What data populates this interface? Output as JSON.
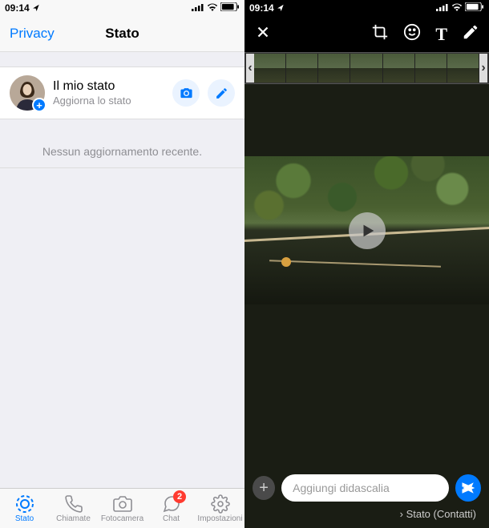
{
  "status_bar": {
    "time": "09:14"
  },
  "left": {
    "header": {
      "privacy": "Privacy",
      "title": "Stato"
    },
    "my_status": {
      "title": "Il mio stato",
      "subtitle": "Aggiorna lo stato"
    },
    "empty": "Nessun aggiornamento recente.",
    "tabs": {
      "stato": "Stato",
      "chiamate": "Chiamate",
      "fotocamera": "Fotocamera",
      "chat": "Chat",
      "chat_badge": "2",
      "impostazioni": "Impostazioni"
    }
  },
  "right": {
    "caption_placeholder": "Aggiungi didascalia",
    "audience_label": "Stato (Contatti)",
    "audience_chevron": "›"
  },
  "icons": {
    "plus": "+"
  }
}
